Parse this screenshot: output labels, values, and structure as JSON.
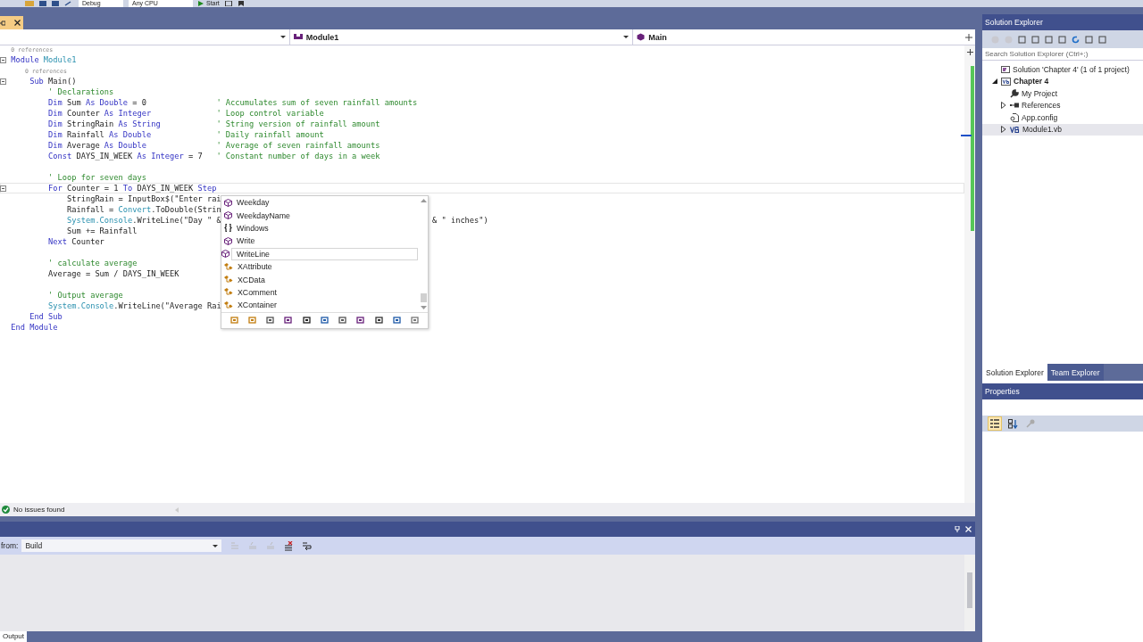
{
  "toolbar": {
    "items": [
      {
        "kind": "combo",
        "label": "Debug"
      },
      {
        "kind": "combo",
        "label": "Any CPU"
      },
      {
        "kind": "start",
        "label": "Start"
      }
    ]
  },
  "nav_bar": {
    "type": "Module1",
    "member": "Main"
  },
  "editor": {
    "lines": [
      {
        "fold": false,
        "current": false,
        "segs": [
          {
            "kind": "lens",
            "text": "0 references"
          }
        ]
      },
      {
        "fold": true,
        "current": false,
        "segs": [
          {
            "kind": "kw",
            "text": "Module "
          },
          {
            "kind": "type",
            "text": "Module1"
          }
        ]
      },
      {
        "fold": false,
        "current": false,
        "segs": [
          {
            "kind": "lens",
            "text": "    0 references"
          }
        ]
      },
      {
        "fold": true,
        "current": false,
        "segs": [
          {
            "kind": "kw",
            "text": "    Sub "
          },
          {
            "kind": "plain",
            "text": "Main()"
          }
        ]
      },
      {
        "fold": false,
        "current": false,
        "segs": [
          {
            "kind": "comment",
            "text": "        ' Declarations"
          }
        ]
      },
      {
        "fold": false,
        "current": false,
        "segs": [
          {
            "kind": "kw",
            "text": "        Dim "
          },
          {
            "kind": "plain",
            "text": "Sum "
          },
          {
            "kind": "kw",
            "text": "As Double "
          },
          {
            "kind": "plain",
            "text": "= 0"
          },
          {
            "kind": "comment",
            "text": "               ' Accumulates sum of seven rainfall amounts"
          }
        ]
      },
      {
        "fold": false,
        "current": false,
        "segs": [
          {
            "kind": "kw",
            "text": "        Dim "
          },
          {
            "kind": "plain",
            "text": "Counter "
          },
          {
            "kind": "kw",
            "text": "As Integer"
          },
          {
            "kind": "comment",
            "text": "              ' Loop control variable"
          }
        ]
      },
      {
        "fold": false,
        "current": false,
        "segs": [
          {
            "kind": "kw",
            "text": "        Dim "
          },
          {
            "kind": "plain",
            "text": "StringRain "
          },
          {
            "kind": "kw",
            "text": "As String"
          },
          {
            "kind": "comment",
            "text": "            ' String version of rainfall amount"
          }
        ]
      },
      {
        "fold": false,
        "current": false,
        "segs": [
          {
            "kind": "kw",
            "text": "        Dim "
          },
          {
            "kind": "plain",
            "text": "Rainfall "
          },
          {
            "kind": "kw",
            "text": "As Double"
          },
          {
            "kind": "comment",
            "text": "              ' Daily rainfall amount"
          }
        ]
      },
      {
        "fold": false,
        "current": false,
        "segs": [
          {
            "kind": "kw",
            "text": "        Dim "
          },
          {
            "kind": "plain",
            "text": "Average "
          },
          {
            "kind": "kw",
            "text": "As Double"
          },
          {
            "kind": "comment",
            "text": "               ' Average of seven rainfall amounts"
          }
        ]
      },
      {
        "fold": false,
        "current": false,
        "segs": [
          {
            "kind": "kw",
            "text": "        Const "
          },
          {
            "kind": "plain",
            "text": "DAYS_IN_WEEK "
          },
          {
            "kind": "kw",
            "text": "As Integer "
          },
          {
            "kind": "plain",
            "text": "= 7"
          },
          {
            "kind": "comment",
            "text": "   ' Constant number of days in a week"
          }
        ]
      },
      {
        "fold": false,
        "current": false
      },
      {
        "fold": false,
        "current": false,
        "segs": [
          {
            "kind": "comment",
            "text": "        ' Loop for seven days"
          }
        ]
      },
      {
        "fold": true,
        "current": true,
        "segs": [
          {
            "kind": "kw",
            "text": "        For "
          },
          {
            "kind": "plain",
            "text": "Counter = 1 "
          },
          {
            "kind": "kw",
            "text": "To "
          },
          {
            "kind": "plain",
            "text": "DAYS_IN_WEEK "
          },
          {
            "kind": "kw",
            "text": "Step"
          }
        ]
      },
      {
        "fold": false,
        "current": false,
        "segs": [
          {
            "kind": "plain",
            "text": "            StringRain = InputBox$(\"Enter rai"
          }
        ]
      },
      {
        "fold": false,
        "current": false,
        "segs": [
          {
            "kind": "plain",
            "text": "            Rainfall = "
          },
          {
            "kind": "type",
            "text": "Convert"
          },
          {
            "kind": "plain",
            "text": ".ToDouble(Strin"
          }
        ]
      },
      {
        "fold": false,
        "current": false,
        "segs": [
          {
            "kind": "type",
            "text": "            System.Console"
          },
          {
            "kind": "plain",
            "text": ".WriteLine(\"Day \" &"
          }
        ],
        "tail": [
          {
            "kind": "plain",
            "text": "& \" inches\")"
          }
        ]
      },
      {
        "fold": false,
        "current": false,
        "segs": [
          {
            "kind": "plain",
            "text": "            Sum += Rainfall"
          }
        ]
      },
      {
        "fold": false,
        "current": false,
        "segs": [
          {
            "kind": "kw",
            "text": "        Next "
          },
          {
            "kind": "plain",
            "text": "Counter"
          }
        ]
      },
      {
        "fold": false,
        "current": false
      },
      {
        "fold": false,
        "current": false,
        "segs": [
          {
            "kind": "comment",
            "text": "        ' calculate average"
          }
        ]
      },
      {
        "fold": false,
        "current": false,
        "segs": [
          {
            "kind": "plain",
            "text": "        Average = Sum / DAYS_IN_WEEK"
          }
        ]
      },
      {
        "fold": false,
        "current": false
      },
      {
        "fold": false,
        "current": false,
        "segs": [
          {
            "kind": "comment",
            "text": "        ' Output average"
          }
        ]
      },
      {
        "fold": false,
        "current": false,
        "segs": [
          {
            "kind": "type",
            "text": "        System.Console"
          },
          {
            "kind": "plain",
            "text": ".WriteLine(\"Average Rai"
          }
        ]
      },
      {
        "fold": false,
        "current": false,
        "segs": [
          {
            "kind": "kw",
            "text": "    End Sub"
          }
        ]
      },
      {
        "fold": false,
        "current": false,
        "segs": [
          {
            "kind": "kw",
            "text": "End Module"
          }
        ]
      }
    ]
  },
  "completion": {
    "items": [
      {
        "label": "Weekday",
        "kind": "method",
        "selected": false
      },
      {
        "label": "WeekdayName",
        "kind": "method",
        "selected": false
      },
      {
        "label": "Windows",
        "kind": "namespace",
        "selected": false
      },
      {
        "label": "Write",
        "kind": "method",
        "selected": false
      },
      {
        "label": "WriteLine",
        "kind": "method",
        "selected": true
      },
      {
        "label": "XAttribute",
        "kind": "class",
        "selected": false
      },
      {
        "label": "XCData",
        "kind": "class",
        "selected": false
      },
      {
        "label": "XComment",
        "kind": "class",
        "selected": false
      },
      {
        "label": "XContainer",
        "kind": "class",
        "selected": false
      }
    ]
  },
  "status": {
    "text": "No issues found"
  },
  "output": {
    "from_label": "from:",
    "source": "Build",
    "tab": "Output"
  },
  "solution_explorer": {
    "title": "Solution Explorer",
    "search": {
      "placeholder": "Search Solution Explorer (Ctrl+;)"
    },
    "tree": [
      {
        "label": "Solution 'Chapter 4' (1 of 1 project)",
        "kind": "solution",
        "selected": false,
        "children": [
          {
            "label": "Chapter 4",
            "kind": "project",
            "expanded": true,
            "selected": false,
            "children": [
              {
                "label": "My Project",
                "kind": "settings",
                "selected": false
              },
              {
                "label": "References",
                "kind": "references",
                "expanded": false,
                "selected": false
              },
              {
                "label": "App.config",
                "kind": "config",
                "selected": false
              },
              {
                "label": "Module1.vb",
                "kind": "vbfile",
                "expanded": false,
                "selected": true
              }
            ]
          }
        ]
      }
    ]
  },
  "panel_tabs": [
    {
      "label": "Solution Explorer",
      "selected": true
    },
    {
      "label": "Team Explorer",
      "selected": false
    }
  ],
  "properties": {
    "title": "Properties",
    "tools": [
      {
        "kind": "categorized",
        "selected": true
      },
      {
        "kind": "alphabetical",
        "selected": false
      },
      {
        "kind": "pages",
        "selected": false
      }
    ]
  }
}
